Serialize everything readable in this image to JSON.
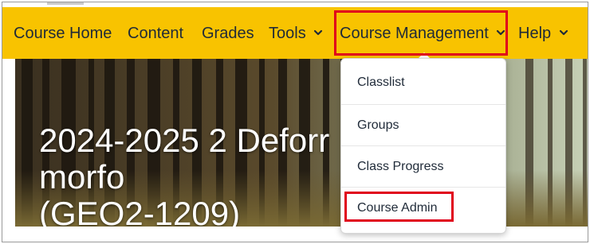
{
  "nav": {
    "items": [
      {
        "label": "Course Home"
      },
      {
        "label": "Content"
      },
      {
        "label": "Grades"
      },
      {
        "label": "Tools"
      },
      {
        "label": "Course Management"
      },
      {
        "label": "Help"
      }
    ],
    "background_color": "#f8c300",
    "highlight_color": "#e0001b"
  },
  "banner": {
    "title_line1": "2024-2025 2 Deforr",
    "title_line1_end": "morfo",
    "title_line2": "(GEO2-1209)"
  },
  "dropdown": {
    "items": [
      {
        "label": "Classlist"
      },
      {
        "label": "Groups"
      },
      {
        "label": "Class Progress"
      },
      {
        "label": "Course Admin"
      }
    ]
  },
  "icons": {
    "dropdown_chevron": "chevron-down-icon"
  }
}
